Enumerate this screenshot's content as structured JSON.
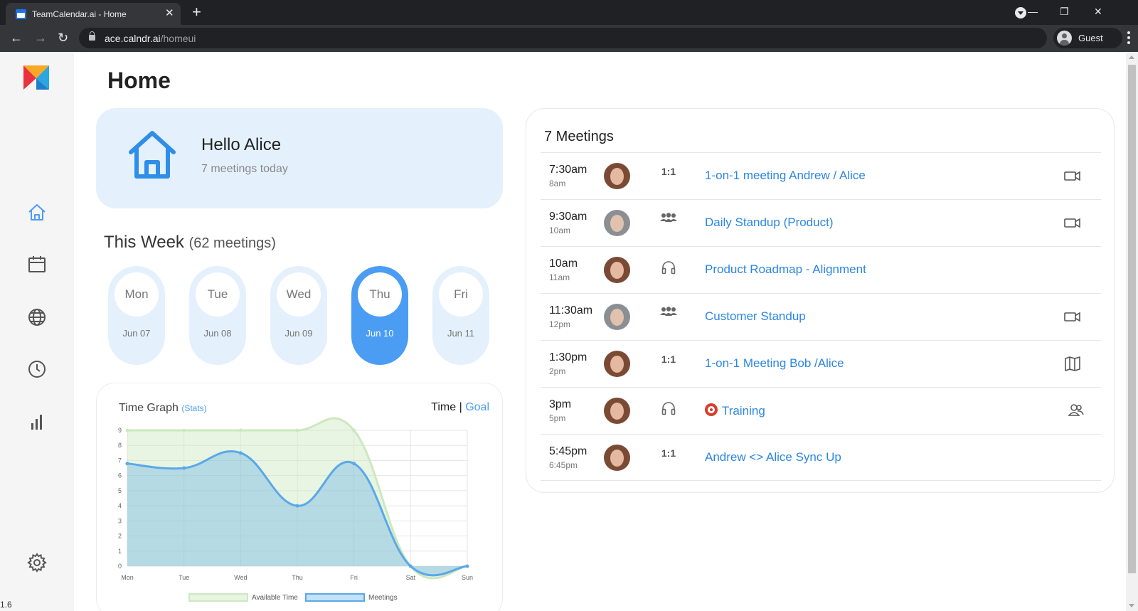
{
  "browser": {
    "tab_title": "TeamCalendar.ai - Home",
    "tab_close": "✕",
    "new_tab": "+",
    "url_host": "ace.calndr.ai",
    "url_path": "/homeui",
    "profile_label": "Guest",
    "minimize": "—",
    "restore": "❐",
    "close": "✕",
    "back": "←",
    "forward": "→",
    "reload": "↻"
  },
  "sidebar": {
    "version": "1.6",
    "items": [
      {
        "name": "home",
        "active": true
      },
      {
        "name": "calendar",
        "active": false
      },
      {
        "name": "globe",
        "active": false
      },
      {
        "name": "clock",
        "active": false
      },
      {
        "name": "stats",
        "active": false
      },
      {
        "name": "settings",
        "active": false
      }
    ]
  },
  "page": {
    "title": "Home"
  },
  "hello": {
    "title": "Hello Alice",
    "subtitle": "7 meetings today"
  },
  "week": {
    "title": "This Week",
    "count": "(62 meetings)",
    "days": [
      {
        "day": "Mon",
        "date": "Jun 07",
        "active": false
      },
      {
        "day": "Tue",
        "date": "Jun 08",
        "active": false
      },
      {
        "day": "Wed",
        "date": "Jun 09",
        "active": false
      },
      {
        "day": "Thu",
        "date": "Jun 10",
        "active": true
      },
      {
        "day": "Fri",
        "date": "Jun 11",
        "active": false
      }
    ]
  },
  "graph": {
    "title": "Time Graph",
    "stats_link": "(Stats)",
    "toggle_time": "Time",
    "toggle_sep": "|",
    "toggle_goal": "Goal"
  },
  "chart_data": {
    "type": "area",
    "title": "Time Graph",
    "categories": [
      "Mon",
      "Tue",
      "Wed",
      "Thu",
      "Fri",
      "Sat",
      "Sun"
    ],
    "series": [
      {
        "name": "Available Time",
        "values": [
          9,
          9,
          9,
          9,
          9,
          0,
          0
        ],
        "color": "#d9eccf"
      },
      {
        "name": "Meetings",
        "values": [
          6.8,
          6.5,
          7.5,
          4,
          6.8,
          0,
          0
        ],
        "color": "#5aa8e8"
      }
    ],
    "ylim": [
      0,
      9
    ],
    "yticks": [
      0,
      1,
      2,
      3,
      4,
      5,
      6,
      7,
      8,
      9
    ],
    "grid": true,
    "legend": "bottom"
  },
  "meetings": {
    "title": "7 Meetings",
    "items": [
      {
        "time": "7:30am",
        "end": "8am",
        "avatar": "female",
        "type": "1:1",
        "type_icon": "",
        "name": "1-on-1 meeting Andrew / Alice",
        "action_icon": "video-icon",
        "emoji": false
      },
      {
        "time": "9:30am",
        "end": "10am",
        "avatar": "male",
        "type": "",
        "type_icon": "group-icon",
        "name": "Daily Standup (Product)",
        "action_icon": "video-icon",
        "emoji": false
      },
      {
        "time": "10am",
        "end": "11am",
        "avatar": "female",
        "type": "",
        "type_icon": "headphones-icon",
        "name": "Product Roadmap - Alignment",
        "action_icon": "",
        "emoji": false
      },
      {
        "time": "11:30am",
        "end": "12pm",
        "avatar": "male",
        "type": "",
        "type_icon": "group-icon",
        "name": "Customer Standup",
        "action_icon": "video-icon",
        "emoji": false
      },
      {
        "time": "1:30pm",
        "end": "2pm",
        "avatar": "female",
        "type": "1:1",
        "type_icon": "",
        "name": "1-on-1 Meeting Bob /Alice",
        "action_icon": "map-icon",
        "emoji": false
      },
      {
        "time": "3pm",
        "end": "5pm",
        "avatar": "female",
        "type": "",
        "type_icon": "headphones-icon",
        "name": "Training",
        "action_icon": "people-icon",
        "emoji": true
      },
      {
        "time": "5:45pm",
        "end": "6:45pm",
        "avatar": "female",
        "type": "1:1",
        "type_icon": "",
        "name": "Andrew <> Alice Sync Up",
        "action_icon": "",
        "emoji": false
      }
    ]
  },
  "colors": {
    "accent": "#4b9df3",
    "link": "#2b86e3",
    "card_bg": "#e4f1fd"
  }
}
